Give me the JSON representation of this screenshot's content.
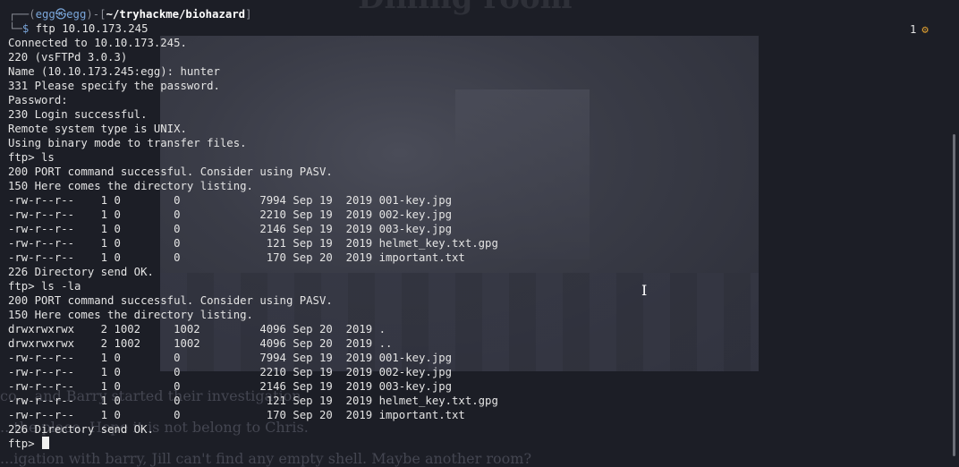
{
  "background_page": {
    "heading": "Dining room",
    "lines": [
      "co... and Barry started their investigation",
      "...the place. Hope it is not belong to Chris.",
      "...igation with barry, Jill can't find any empty shell. Maybe another room?"
    ]
  },
  "prompt": {
    "user": "egg",
    "host": "egg",
    "at_symbol": "㉿",
    "cwd": "~/tryhackme/biohazard",
    "command": "ftp 10.10.173.245"
  },
  "jobs_indicator": {
    "count": "1",
    "icon": "gear-icon"
  },
  "output_lines": [
    "Connected to 10.10.173.245.",
    "220 (vsFTPd 3.0.3)",
    "Name (10.10.173.245:egg): hunter",
    "331 Please specify the password.",
    "Password:",
    "230 Login successful.",
    "Remote system type is UNIX.",
    "Using binary mode to transfer files.",
    "ftp> ls",
    "200 PORT command successful. Consider using PASV.",
    "150 Here comes the directory listing.",
    "-rw-r--r--    1 0        0            7994 Sep 19  2019 001-key.jpg",
    "-rw-r--r--    1 0        0            2210 Sep 19  2019 002-key.jpg",
    "-rw-r--r--    1 0        0            2146 Sep 19  2019 003-key.jpg",
    "-rw-r--r--    1 0        0             121 Sep 19  2019 helmet_key.txt.gpg",
    "-rw-r--r--    1 0        0             170 Sep 20  2019 important.txt",
    "226 Directory send OK.",
    "ftp> ls -la",
    "200 PORT command successful. Consider using PASV.",
    "150 Here comes the directory listing.",
    "drwxrwxrwx    2 1002     1002         4096 Sep 20  2019 .",
    "drwxrwxrwx    2 1002     1002         4096 Sep 20  2019 ..",
    "-rw-r--r--    1 0        0            7994 Sep 19  2019 001-key.jpg",
    "-rw-r--r--    1 0        0            2210 Sep 19  2019 002-key.jpg",
    "-rw-r--r--    1 0        0            2146 Sep 19  2019 003-key.jpg",
    "-rw-r--r--    1 0        0             121 Sep 19  2019 helmet_key.txt.gpg",
    "-rw-r--r--    1 0        0             170 Sep 20  2019 important.txt",
    "226 Directory send OK."
  ],
  "input_prompt": "ftp> ",
  "colors": {
    "terminal_text": "#e4e4e4",
    "accent_cyan": "#7aa6da",
    "gear": "#e0a030"
  }
}
